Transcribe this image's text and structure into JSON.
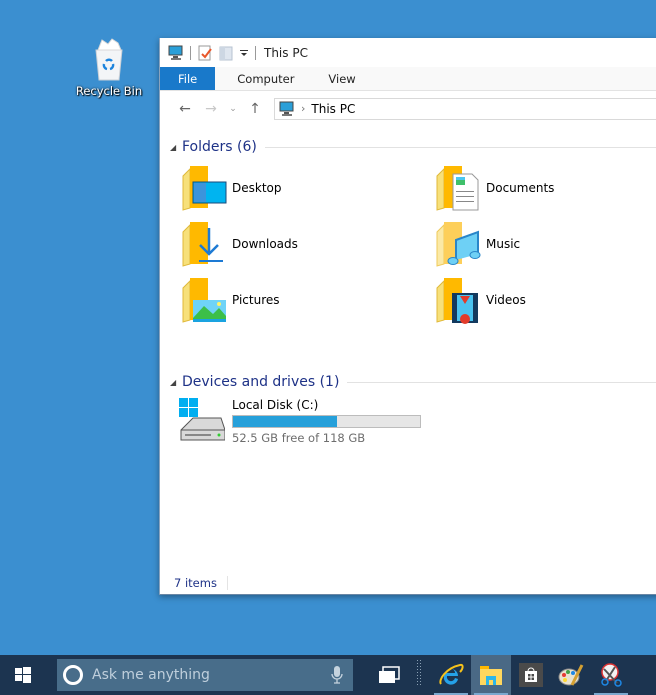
{
  "desktop": {
    "icons": [
      {
        "label": "Recycle Bin",
        "icon": "recycle-bin-icon"
      }
    ]
  },
  "window": {
    "title": "This PC",
    "quick_access": [
      "computer-icon",
      "properties-icon",
      "new-folder-icon",
      "customize-dropdown-icon"
    ],
    "ribbon_tabs": [
      {
        "label": "File",
        "active": true
      },
      {
        "label": "Computer"
      },
      {
        "label": "View"
      }
    ],
    "nav": {
      "back": "←",
      "forward": "→",
      "recent": "⌄",
      "up": "↑",
      "address_sep": "›",
      "address": "This PC"
    },
    "groups": {
      "folders": {
        "title": "Folders (6)",
        "collapse_glyph": "◢"
      },
      "devices": {
        "title": "Devices and drives (1)",
        "collapse_glyph": "◢"
      }
    },
    "folders": [
      {
        "name": "Desktop",
        "icon": "desktop-folder-icon"
      },
      {
        "name": "Documents",
        "icon": "documents-folder-icon"
      },
      {
        "name": "Downloads",
        "icon": "downloads-folder-icon"
      },
      {
        "name": "Music",
        "icon": "music-folder-icon"
      },
      {
        "name": "Pictures",
        "icon": "pictures-folder-icon"
      },
      {
        "name": "Videos",
        "icon": "videos-folder-icon"
      }
    ],
    "drives": [
      {
        "name": "Local Disk (C:)",
        "free_text": "52.5 GB free of 118 GB",
        "free_gb": 52.5,
        "total_gb": 118,
        "used_fraction": 0.555,
        "bar_color": "#26a0da"
      }
    ],
    "status": {
      "items": "7 items"
    }
  },
  "taskbar": {
    "search_placeholder": "Ask me anything",
    "apps": [
      {
        "name": "task-view",
        "active": false
      },
      {
        "name": "internet-explorer",
        "active": false,
        "running": true
      },
      {
        "name": "file-explorer",
        "active": true,
        "running": true
      },
      {
        "name": "store",
        "active": false
      },
      {
        "name": "paint",
        "active": false
      },
      {
        "name": "snipping-tool",
        "active": false,
        "running": true
      }
    ]
  },
  "colors": {
    "desktop_bg": "#3b8fd0",
    "taskbar_bg": "#1c3450",
    "file_tab": "#1979ca",
    "group_header": "#1e3287"
  }
}
